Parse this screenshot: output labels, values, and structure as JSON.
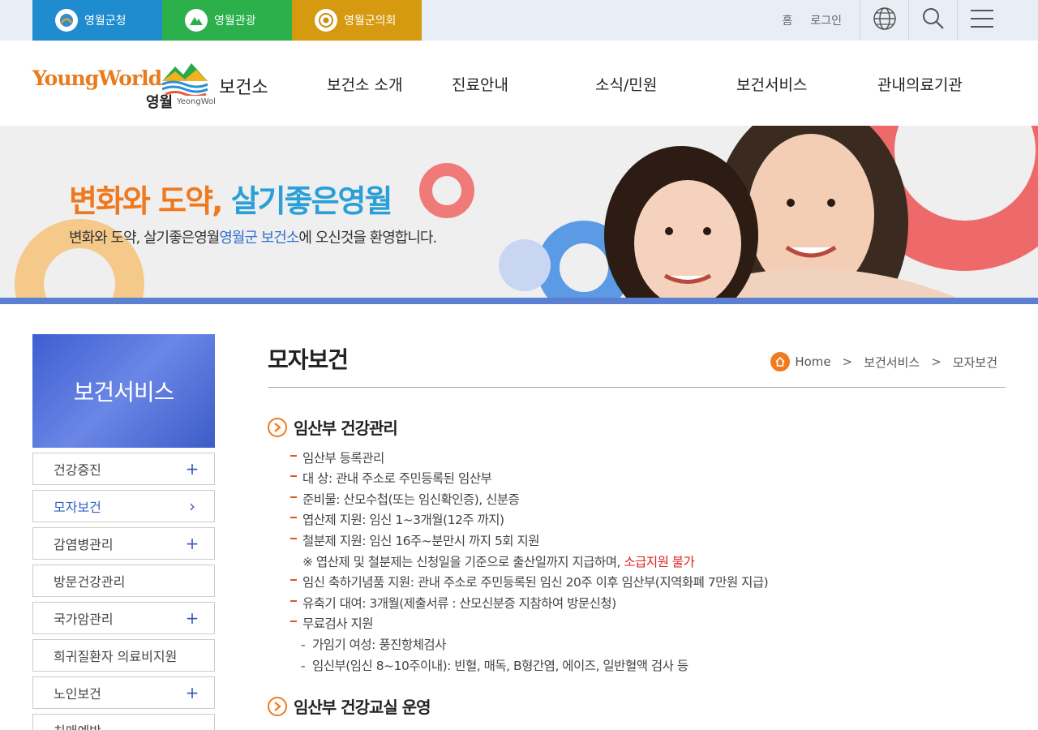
{
  "topbar": {
    "site_tabs": [
      {
        "label": "영월군청",
        "color": "#1e8ccf"
      },
      {
        "label": "영월관광",
        "color": "#2bb04c"
      },
      {
        "label": "영월군의회",
        "color": "#d69a10"
      }
    ],
    "links": [
      "홈",
      "로그인"
    ],
    "icons": [
      "globe-icon",
      "search-icon",
      "menu-icon"
    ]
  },
  "header": {
    "logo_text": "YoungWorld",
    "logo_korean": "영월",
    "logo_roman": "YeongWol",
    "dept": "보건소",
    "gnb": [
      "보건소 소개",
      "진료안내",
      "소식/민원",
      "보건서비스",
      "관내의료기관"
    ]
  },
  "banner": {
    "title_part1": "변화와 도약, ",
    "title_part2": "살기좋은영월",
    "sub_part1": "변화와 도약, 살기좋은영월",
    "sub_highlight": "영월군 보건소",
    "sub_part2": "에 오신것을 환영합니다."
  },
  "sidebar": {
    "title": "보건서비스",
    "items": [
      {
        "label": "건강증진",
        "mark": "+"
      },
      {
        "label": "모자보건",
        "mark": "›"
      },
      {
        "label": "감염병관리",
        "mark": "+"
      },
      {
        "label": "방문건강관리",
        "mark": ""
      },
      {
        "label": "국가암관리",
        "mark": "+"
      },
      {
        "label": "희귀질환자 의료비지원",
        "mark": ""
      },
      {
        "label": "노인보건",
        "mark": "+"
      },
      {
        "label": "치매예방",
        "mark": ""
      }
    ]
  },
  "content": {
    "page_title": "모자보건",
    "breadcrumb": [
      "Home",
      "보건서비스",
      "모자보건"
    ],
    "sections": [
      {
        "title": "임산부 건강관리"
      },
      {
        "title": "임산부 건강교실 운영"
      }
    ],
    "items": [
      "임산부 등록관리",
      "대 상: 관내 주소로 주민등록된 임산부",
      "준비물: 산모수첩(또는 임신확인증), 신분증",
      "엽산제 지원: 임신 1~3개월(12주 까지)",
      "철분제 지원: 임신 16주~분만시 까지 5회 지원",
      "임신 축하기념품 지원: 관내 주소로 주민등록된 임신 20주 이후 임산부(지역화폐 7만원 지급)",
      "유축기 대여: 3개월(제출서류 : 산모신분증 지참하여 방문신청)",
      "무료검사 지원"
    ],
    "note_text": "※ 엽산제 및 철분제는 신청일을 기준으로 출산일까지 지급하며, ",
    "note_red": "소급지원 불가",
    "sub_items": [
      "가임기 여성: 풍진항체검사",
      "임신부(임신 8~10주이내): 빈혈, 매독, B형간염, 에이즈, 일반혈액 검사 등"
    ]
  }
}
